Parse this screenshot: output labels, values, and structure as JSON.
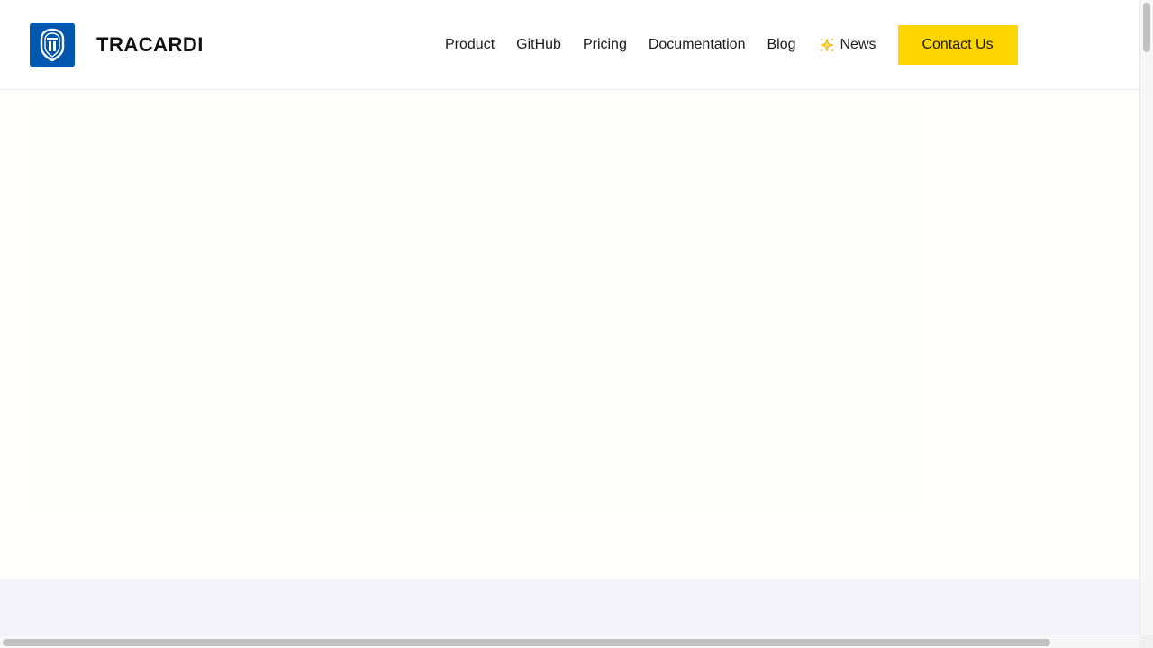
{
  "header": {
    "brand": "TRACARDI",
    "logo_icon": "tracardi-shield-logo",
    "nav": [
      {
        "label": "Product"
      },
      {
        "label": "GitHub"
      },
      {
        "label": "Pricing"
      },
      {
        "label": "Documentation"
      },
      {
        "label": "Blog"
      },
      {
        "label": "News",
        "icon": "sparkle-star-icon"
      }
    ],
    "contact_label": "Contact Us"
  },
  "colors": {
    "brand_blue": "#0057b0",
    "contact_button": "#ffd600",
    "footer_band": "#f4f3fc"
  }
}
